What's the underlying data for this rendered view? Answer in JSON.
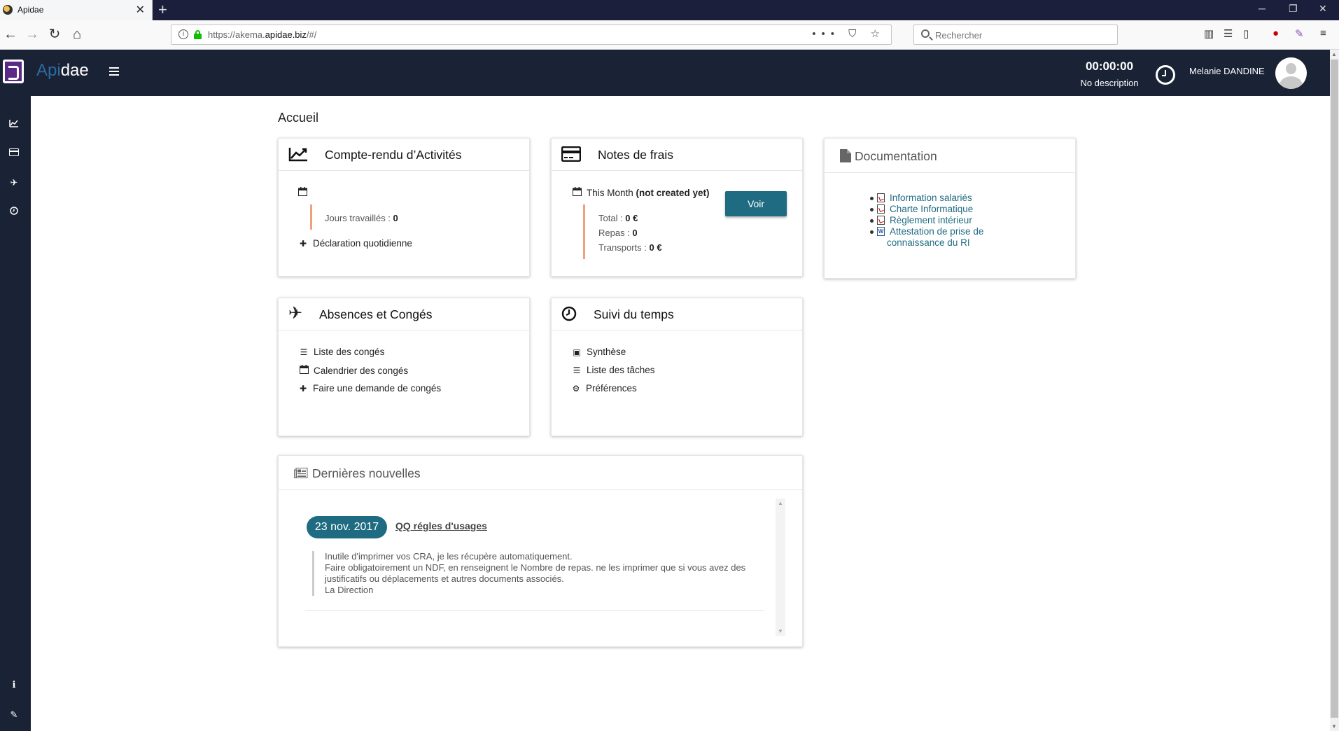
{
  "browser": {
    "tab_title": "Apidae",
    "tab_close": "✕",
    "new_tab": "+",
    "url_prefix": "https://akema.",
    "url_domain": "apidae.biz",
    "url_suffix": "/#/",
    "url_actions": "••• ⛉ ☆",
    "search_placeholder": "Rechercher",
    "window_controls": {
      "minimize": "─",
      "restore": "❐",
      "close": "✕"
    },
    "nav": {
      "back": "←",
      "forward": "→",
      "reload": "↻",
      "home": "⌂"
    }
  },
  "header": {
    "brand_prefix": "Api",
    "brand_suffix": "dae",
    "timer": "00:00:00",
    "timer_desc": "No description",
    "user_name": "Melanie DANDINE"
  },
  "page": {
    "title": "Accueil"
  },
  "cra": {
    "title": "Compte-rendu d’Activités",
    "jours_label": "Jours travaillés : ",
    "jours_value": "0",
    "declaration": "Déclaration quotidienne"
  },
  "frais": {
    "title": "Notes de frais",
    "period": "This Month ",
    "period_status": "(not created yet)",
    "voir": "Voir",
    "total_label": "Total : ",
    "total_value": "0 €",
    "repas_label": "Repas : ",
    "repas_value": "0",
    "transports_label": "Transports : ",
    "transports_value": "0 €"
  },
  "documentation": {
    "title": "Documentation",
    "items": [
      "Information salariés",
      "Charte Informatique",
      "Règlement intérieur",
      "Attestation de prise de connaissance du RI"
    ]
  },
  "absences": {
    "title": "Absences et Congés",
    "items": [
      "Liste des congés",
      "Calendrier des congés",
      "Faire une demande de congés"
    ]
  },
  "suivi": {
    "title": "Suivi du temps",
    "items": [
      "Synthèse",
      "Liste des tâches",
      "Préférences"
    ]
  },
  "news": {
    "title": "Dernières nouvelles",
    "date": "23 nov. 2017",
    "link": "QQ régles d'usages",
    "lines": [
      "Inutile d'imprimer vos CRA, je les récupère automatiquement.",
      "Faire obligatoirement un NDF, en renseignent le Nombre de repas. ne les imprimer que si vous avez des justificatifs ou déplacements et autres documents associés.",
      "La Direction"
    ]
  },
  "colors": {
    "header_bg": "#1a2236",
    "accent": "#1f6b82",
    "orange_bar": "#f0a07a",
    "brand_purple": "#5b2a86"
  },
  "icons": {
    "cra": "chart-line-icon",
    "frais": "credit-card-icon",
    "documentation": "file-icon",
    "absences": "plane-icon",
    "suivi": "clock-icon",
    "news": "newspaper-icon"
  }
}
